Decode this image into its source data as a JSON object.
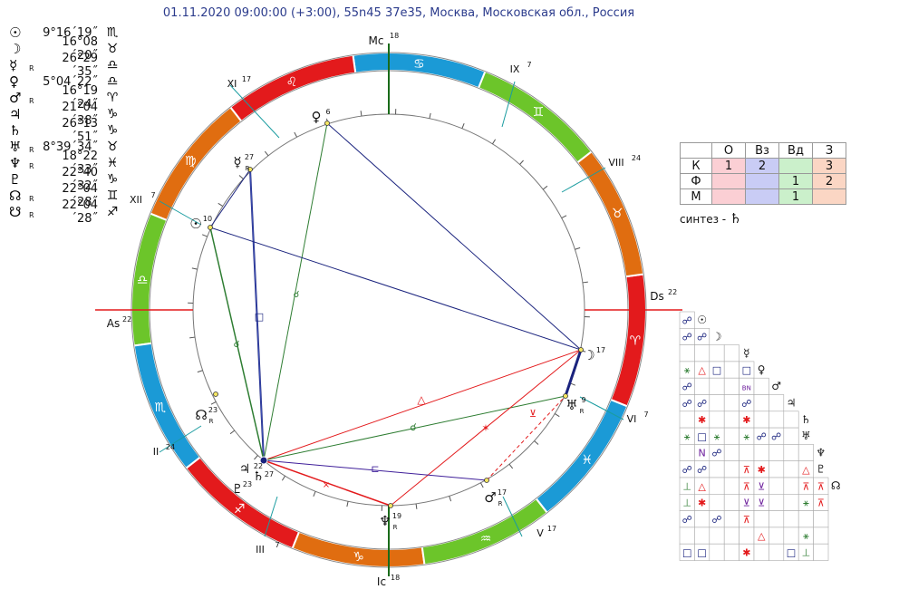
{
  "header": "01.11.2020 09:00:00 (+3:00), 55n45 37e35, Москва, Московская обл., Россия",
  "planets": [
    {
      "glyph": "☉",
      "retro": "",
      "value": "9°16´19˝",
      "sign": "♏",
      "sign_color": "#111"
    },
    {
      "glyph": "☽",
      "retro": "",
      "value": "16°08´20˝",
      "sign": "♉",
      "sign_color": "#111"
    },
    {
      "glyph": "☿",
      "retro": "R",
      "value": "26°29´35˝",
      "sign": "♎",
      "sign_color": "#111"
    },
    {
      "glyph": "♀",
      "retro": "",
      "value": "5°04´22˝",
      "sign": "♎",
      "sign_color": "#111"
    },
    {
      "glyph": "♂",
      "retro": "R",
      "value": "16°19´24˝",
      "sign": "♈",
      "sign_color": "#111"
    },
    {
      "glyph": "♃",
      "retro": "",
      "value": "21°04´38˝",
      "sign": "♑",
      "sign_color": "#111"
    },
    {
      "glyph": "♄",
      "retro": "",
      "value": "26°13´51˝",
      "sign": "♑",
      "sign_color": "#111"
    },
    {
      "glyph": "♅",
      "retro": "R",
      "value": "8°39´34˝",
      "sign": "♉",
      "sign_color": "#111"
    },
    {
      "glyph": "♆",
      "retro": "R",
      "value": "18°22´33˝",
      "sign": "♓",
      "sign_color": "#111"
    },
    {
      "glyph": "♇",
      "retro": "",
      "value": "22°40´32˝",
      "sign": "♑",
      "sign_color": "#111"
    },
    {
      "glyph": "☊",
      "retro": "R",
      "value": "22°04´28˝",
      "sign": "♊",
      "sign_color": "#111"
    },
    {
      "glyph": "☋",
      "retro": "R",
      "value": "22°04´28˝",
      "sign": "♐",
      "sign_color": "#111"
    }
  ],
  "wheel": {
    "angles": {
      "mc": {
        "label": "Mc",
        "deg": "18"
      },
      "ic": {
        "label": "Ic",
        "deg": "18"
      },
      "as": {
        "label": "As",
        "deg": "22"
      },
      "ds": {
        "label": "Ds",
        "deg": "22"
      }
    },
    "houses": [
      {
        "label": "IX",
        "deg": "7"
      },
      {
        "label": "VIII",
        "deg": "24"
      },
      {
        "label": "VI",
        "deg": "7"
      },
      {
        "label": "V",
        "deg": "17"
      },
      {
        "label": "III",
        "deg": "7"
      },
      {
        "label": "II",
        "deg": "24"
      },
      {
        "label": "XII",
        "deg": "7"
      },
      {
        "label": "XI",
        "deg": "17"
      }
    ],
    "points": [
      {
        "glyph": "♀",
        "deg": "6"
      },
      {
        "glyph": "☿",
        "deg": "27",
        "retro": "R"
      },
      {
        "glyph": "☉",
        "deg": "10"
      },
      {
        "glyph": "☊",
        "deg": "23",
        "retro": "R"
      },
      {
        "glyph": "☽",
        "deg": "17"
      },
      {
        "glyph": "♅",
        "deg": "9",
        "retro": "R"
      },
      {
        "glyph": "♂",
        "deg": "17",
        "retro": "R"
      },
      {
        "glyph": "♆",
        "deg": "19",
        "retro": "R"
      },
      {
        "glyph": "♃",
        "deg": "22"
      },
      {
        "glyph": "♄",
        "deg": "27"
      },
      {
        "glyph": "♇",
        "deg": "23"
      },
      {
        "glyph": "☋",
        "deg": "23",
        "retro": "R"
      }
    ],
    "zodiac_colors": {
      "fire": "#e31a1c",
      "earth": "#e06d10",
      "air": "#6cc52a",
      "water": "#1b9ad6"
    }
  },
  "elements_table": {
    "columns": [
      "",
      "О",
      "Вз",
      "Вд",
      "З"
    ],
    "rows": [
      {
        "label": "К",
        "cells": [
          "1",
          "2",
          "",
          "3"
        ]
      },
      {
        "label": "Ф",
        "cells": [
          "",
          "",
          "1",
          "2"
        ]
      },
      {
        "label": "М",
        "cells": [
          "",
          "",
          "1",
          ""
        ]
      }
    ],
    "column_colors": [
      "#fbcfd4",
      "#c9ccf5",
      "#cbf0cb",
      "#fbd6c4"
    ]
  },
  "synthesis": {
    "label": "синтез -",
    "glyph": "♄"
  },
  "aspect_grid": {
    "header_glyphs": [
      "☉",
      "☽",
      "☿",
      "♀",
      "♂",
      "♃",
      "♄",
      "♅",
      "♆",
      "♇",
      "☊"
    ],
    "rows": [
      [
        "☍"
      ],
      [
        "☍",
        "☍"
      ],
      [
        "",
        "",
        "",
        ""
      ],
      [
        "⚹",
        "△",
        "□",
        "",
        "□"
      ],
      [
        "☍",
        "",
        "",
        "",
        "BN",
        ""
      ],
      [
        "☍",
        "☍",
        "",
        "",
        "☍",
        "",
        ""
      ],
      [
        "",
        "✱",
        "",
        "",
        "✱",
        "",
        "",
        ""
      ],
      [
        "⚹",
        "□",
        "⚹",
        "",
        "⚹",
        "☍",
        "☍",
        ""
      ],
      [
        "",
        "N",
        "☍",
        "",
        "",
        "",
        "",
        "",
        ""
      ],
      [
        "☍",
        "☍",
        "",
        "",
        "⊼",
        "✱",
        "",
        "",
        "△"
      ],
      [
        "⊥",
        "△",
        "",
        "",
        "⊼",
        "⊻",
        "",
        "",
        "⊼",
        "⊼"
      ],
      [
        "⊥",
        "✱",
        "",
        "",
        "⊻",
        "⊻",
        "",
        "",
        "⚹",
        "⊼"
      ],
      [
        "☍",
        "",
        "☍",
        "",
        "⊼",
        "",
        "",
        "",
        "",
        ""
      ],
      [
        "",
        "",
        "",
        "",
        "",
        "△",
        "",
        "",
        "⚹",
        ""
      ],
      [
        "□",
        "□",
        "",
        "",
        "✱",
        "",
        "",
        "□",
        "⊥",
        ""
      ]
    ]
  }
}
